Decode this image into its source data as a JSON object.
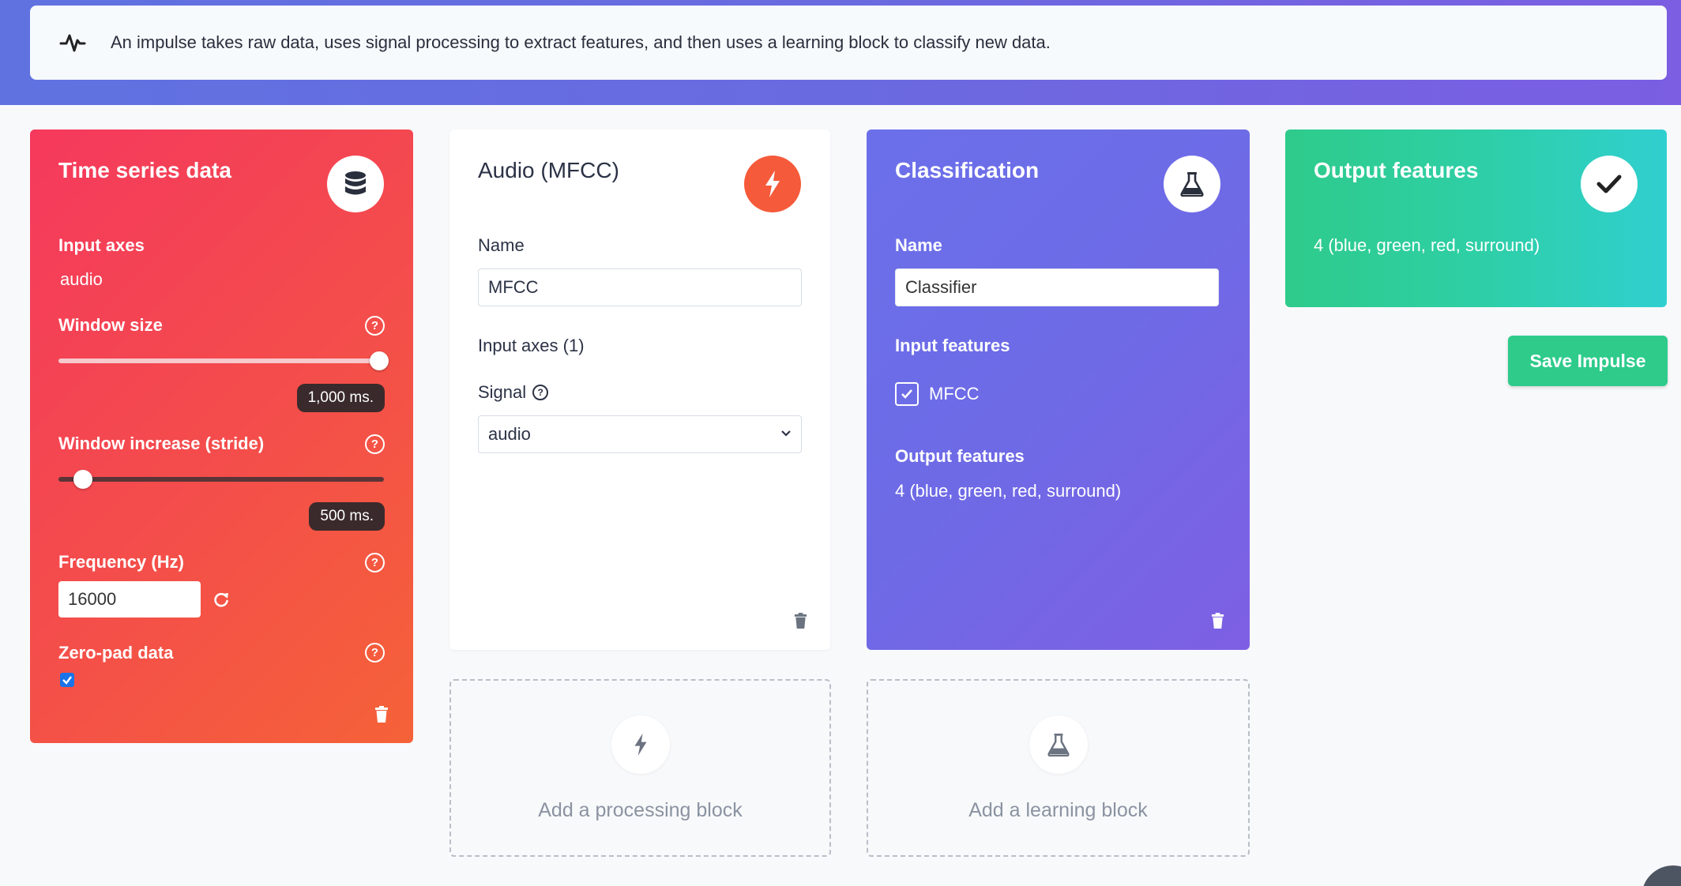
{
  "info": {
    "text": "An impulse takes raw data, uses signal processing to extract features, and then uses a learning block to classify new data."
  },
  "time_series": {
    "title": "Time series data",
    "input_axes_label": "Input axes",
    "input_axes_value": "audio",
    "window_size_label": "Window size",
    "window_size_value": "1,000 ms.",
    "window_size_fraction": 1.0,
    "stride_label": "Window increase (stride)",
    "stride_value": "500 ms.",
    "stride_fraction": 0.05,
    "frequency_label": "Frequency (Hz)",
    "frequency_value": "16000",
    "zero_pad_label": "Zero-pad data",
    "zero_pad_checked": true,
    "help_glyph": "?"
  },
  "mfcc": {
    "title": "Audio (MFCC)",
    "name_label": "Name",
    "name_value": "MFCC",
    "input_axes_label": "Input axes (1)",
    "signal_label": "Signal",
    "signal_value": "audio"
  },
  "classification": {
    "title": "Classification",
    "name_label": "Name",
    "name_value": "Classifier",
    "input_features_label": "Input features",
    "input_feature_item": "MFCC",
    "output_features_label": "Output features",
    "output_features_value": "4 (blue, green, red, surround)"
  },
  "output": {
    "title": "Output features",
    "value": "4 (blue, green, red, surround)"
  },
  "save_button": "Save Impulse",
  "add_processing": "Add a processing block",
  "add_learning": "Add a learning block",
  "colors": {
    "time_series_gradient": [
      "#f5395d",
      "#f56238"
    ],
    "classification_gradient": [
      "#6b70ea",
      "#7e5fe3"
    ],
    "output_gradient": [
      "#2ecb8b",
      "#30cfd0"
    ],
    "processing_badge": "#f55a3a",
    "save_button": "#2ecb8b"
  }
}
